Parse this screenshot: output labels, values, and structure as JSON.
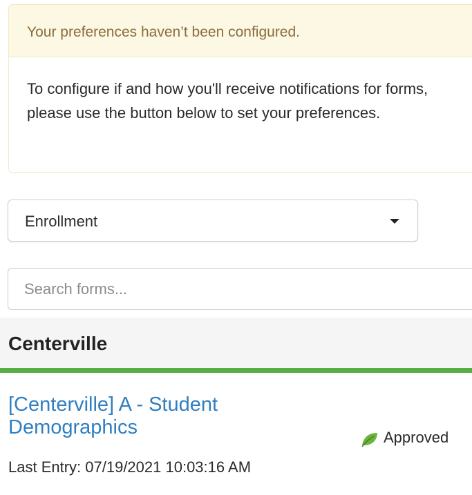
{
  "alert": {
    "heading": "Your preferences haven’t been configured.",
    "body": "To configure if and how you'll receive notifications for forms, please use the button below to set your preferences."
  },
  "category_select": {
    "selected": "Enrollment"
  },
  "search": {
    "placeholder": "Search forms..."
  },
  "group": {
    "title": "Centerville"
  },
  "form_entry": {
    "title": "[Centerville] A - Student Demographics",
    "status": "Approved",
    "status_icon": "leaf-icon",
    "last_entry": "Last Entry: 07/19/2021 10:03:16 AM"
  },
  "colors": {
    "alert_background": "#fcf8e3",
    "alert_text": "#8a6d3b",
    "link": "#2f7fc1",
    "group_underline": "#57ad3f",
    "leaf": "#6bb53c"
  }
}
